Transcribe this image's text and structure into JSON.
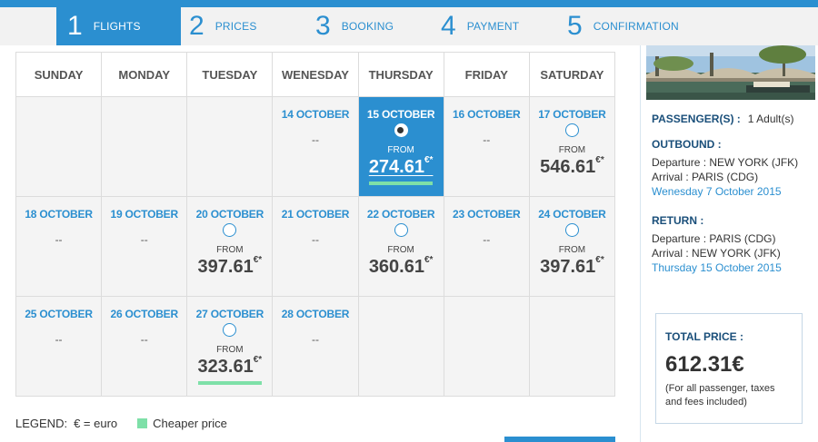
{
  "steps": [
    {
      "num": "1",
      "label": "FLIGHTS"
    },
    {
      "num": "2",
      "label": "PRICES"
    },
    {
      "num": "3",
      "label": "BOOKING"
    },
    {
      "num": "4",
      "label": "PAYMENT"
    },
    {
      "num": "5",
      "label": "CONFIRMATION"
    }
  ],
  "calendar": {
    "days": [
      "SUNDAY",
      "MONDAY",
      "TUESDAY",
      "WENESDAY",
      "THURSDAY",
      "FRIDAY",
      "SATURDAY"
    ],
    "from_label": "FROM",
    "currency_symbol": "€*",
    "no_flight": "--",
    "weeks": [
      [
        {
          "date": "",
          "empty": true
        },
        {
          "date": "",
          "empty": true
        },
        {
          "date": "",
          "empty": true
        },
        {
          "date": "14 OCTOBER"
        },
        {
          "date": "15 OCTOBER",
          "price": "274.61",
          "selected": true,
          "cheaper": true
        },
        {
          "date": "16 OCTOBER"
        },
        {
          "date": "17 OCTOBER",
          "price": "546.61"
        }
      ],
      [
        {
          "date": "18 OCTOBER"
        },
        {
          "date": "19 OCTOBER"
        },
        {
          "date": "20 OCTOBER",
          "price": "397.61"
        },
        {
          "date": "21 OCTOBER"
        },
        {
          "date": "22 OCTOBER",
          "price": "360.61"
        },
        {
          "date": "23 OCTOBER"
        },
        {
          "date": "24 OCTOBER",
          "price": "397.61"
        }
      ],
      [
        {
          "date": "25 OCTOBER"
        },
        {
          "date": "26 OCTOBER"
        },
        {
          "date": "27 OCTOBER",
          "price": "323.61",
          "cheaper": true
        },
        {
          "date": "28 OCTOBER"
        },
        {
          "date": "",
          "empty": true
        },
        {
          "date": "",
          "empty": true
        },
        {
          "date": "",
          "empty": true
        }
      ]
    ]
  },
  "legend": {
    "label": "LEGEND:",
    "euro": "€ = euro",
    "cheaper": "Cheaper price"
  },
  "summary": {
    "passengers_label": "PASSENGER(S) :",
    "passengers_value": "1 Adult(s)",
    "outbound_label": "OUTBOUND :",
    "outbound_departure": "Departure : NEW YORK (JFK)",
    "outbound_arrival": "Arrival : PARIS (CDG)",
    "outbound_date": "Wenesday 7 October 2015",
    "return_label": "RETURN :",
    "return_departure": "Departure : PARIS (CDG)",
    "return_arrival": "Arrival : NEW YORK (JFK)",
    "return_date": "Thursday 15 October 2015",
    "total_label": "TOTAL PRICE :",
    "total_amount": "612.31€",
    "total_note": "(For all passenger, taxes and fees included)"
  },
  "colors": {
    "accent": "#2b8fd0",
    "cheaper": "#7ee0a8",
    "dark_blue": "#1a4f7a"
  }
}
